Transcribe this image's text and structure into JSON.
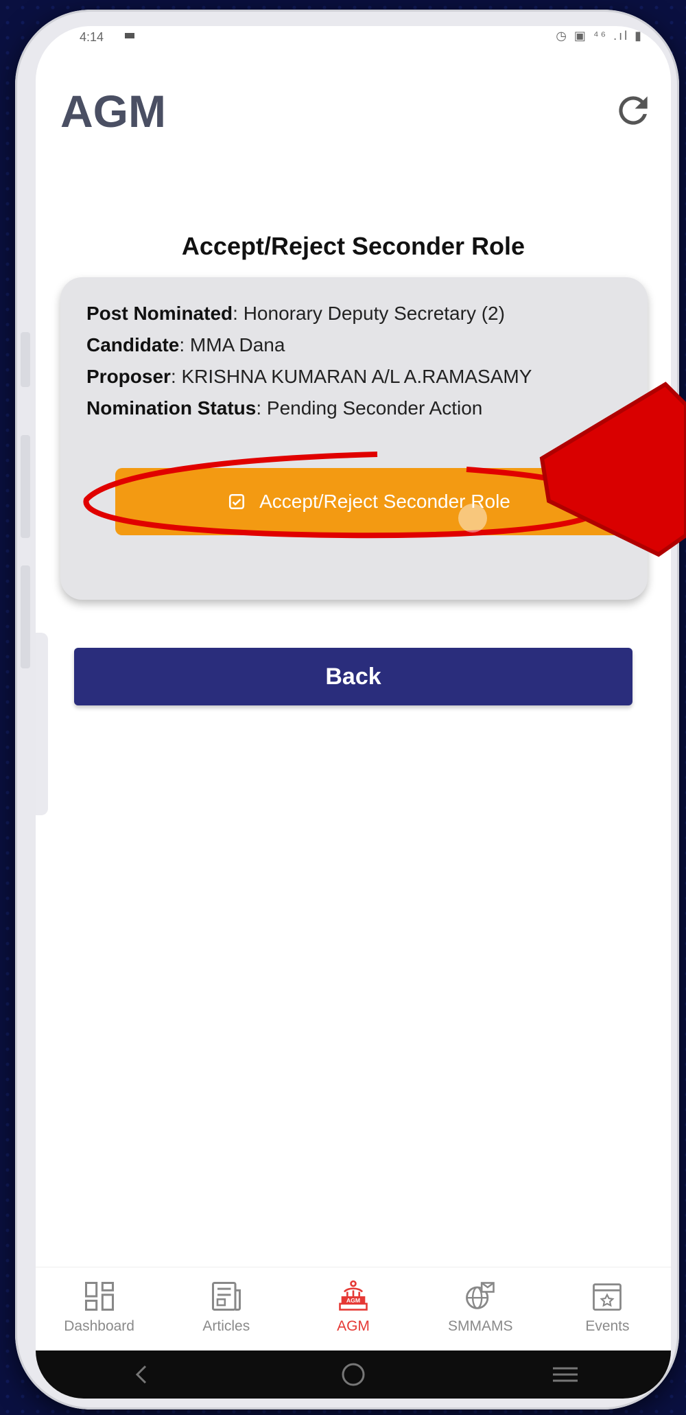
{
  "status_bar": {
    "time": "4:14",
    "icons": "◷ ▣ ⁴⁶ .ıl ▮"
  },
  "header": {
    "title": "AGM",
    "refresh_icon": "refresh-icon"
  },
  "page": {
    "heading": "Accept/Reject Seconder Role"
  },
  "nomination": {
    "post_label": "Post Nominated",
    "post_value": ": Honorary Deputy Secretary (2)",
    "candidate_label": "Candidate",
    "candidate_value": ": MMA Dana",
    "proposer_label": "Proposer",
    "proposer_value": ": KRISHNA KUMARAN A/L A.RAMASAMY",
    "status_label": "Nomination Status",
    "status_value": ": Pending Seconder Action",
    "action_label": "Accept/Reject Seconder Role",
    "action_icon": "check-square-icon"
  },
  "back_label": "Back",
  "bottom_nav": [
    {
      "label": "Dashboard",
      "icon": "dashboard-icon",
      "active": false
    },
    {
      "label": "Articles",
      "icon": "articles-icon",
      "active": false
    },
    {
      "label": "AGM",
      "icon": "agm-podium-icon",
      "active": true
    },
    {
      "label": "SMMAMS",
      "icon": "globe-mail-icon",
      "active": false
    },
    {
      "label": "Events",
      "icon": "calendar-star-icon",
      "active": false
    }
  ],
  "colors": {
    "accept_button": "#f39a12",
    "back_button": "#2a2d7c",
    "active_nav": "#e53935",
    "annotation": "#e00000"
  }
}
